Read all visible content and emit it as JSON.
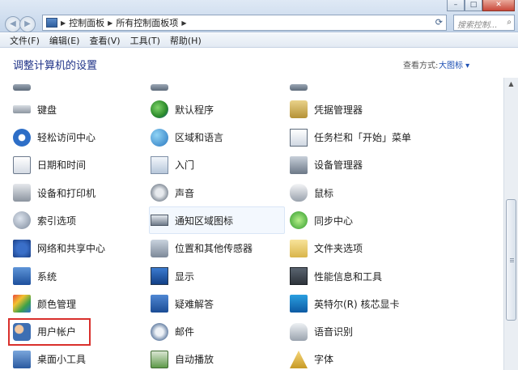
{
  "window": {
    "controls": {
      "minimize": "–",
      "maximize": "□",
      "close": "✕"
    },
    "nav": {
      "back": "◀",
      "forward": "▶"
    }
  },
  "address": {
    "segments": [
      "控制面板",
      "所有控制面板项"
    ],
    "search_placeholder": "搜索控制..."
  },
  "menu": [
    "文件(F)",
    "编辑(E)",
    "查看(V)",
    "工具(T)",
    "帮助(H)"
  ],
  "header": {
    "title": "调整计算机的设置",
    "view_by_label": "查看方式:",
    "view_mode": "大图标 ▾"
  },
  "items": [
    [
      {
        "label": "",
        "icon": "partial-icon"
      },
      {
        "label": "",
        "icon": "partial-icon"
      },
      {
        "label": "",
        "icon": "partial-icon"
      }
    ],
    [
      {
        "label": "键盘",
        "icon": "keyboard-icon"
      },
      {
        "label": "默认程序",
        "icon": "default-programs-icon"
      },
      {
        "label": "凭据管理器",
        "icon": "credential-manager-icon"
      }
    ],
    [
      {
        "label": "轻松访问中心",
        "icon": "ease-of-access-icon"
      },
      {
        "label": "区域和语言",
        "icon": "region-language-icon"
      },
      {
        "label": "任务栏和「开始」菜单",
        "icon": "taskbar-icon"
      }
    ],
    [
      {
        "label": "日期和时间",
        "icon": "date-time-icon"
      },
      {
        "label": "入门",
        "icon": "getting-started-icon"
      },
      {
        "label": "设备管理器",
        "icon": "device-manager-icon"
      }
    ],
    [
      {
        "label": "设备和打印机",
        "icon": "printer-icon"
      },
      {
        "label": "声音",
        "icon": "sound-icon"
      },
      {
        "label": "鼠标",
        "icon": "mouse-icon"
      }
    ],
    [
      {
        "label": "索引选项",
        "icon": "indexing-icon"
      },
      {
        "label": "通知区域图标",
        "icon": "notification-icon"
      },
      {
        "label": "同步中心",
        "icon": "sync-center-icon"
      }
    ],
    [
      {
        "label": "网络和共享中心",
        "icon": "network-icon"
      },
      {
        "label": "位置和其他传感器",
        "icon": "sensor-icon"
      },
      {
        "label": "文件夹选项",
        "icon": "folder-options-icon"
      }
    ],
    [
      {
        "label": "系统",
        "icon": "system-icon"
      },
      {
        "label": "显示",
        "icon": "display-icon"
      },
      {
        "label": "性能信息和工具",
        "icon": "performance-icon"
      }
    ],
    [
      {
        "label": "颜色管理",
        "icon": "color-management-icon"
      },
      {
        "label": "疑难解答",
        "icon": "troubleshooting-icon"
      },
      {
        "label": "英特尔(R) 核芯显卡",
        "icon": "intel-graphics-icon"
      }
    ],
    [
      {
        "label": "用户帐户",
        "icon": "user-accounts-icon"
      },
      {
        "label": "邮件",
        "icon": "mail-icon"
      },
      {
        "label": "语音识别",
        "icon": "speech-icon"
      }
    ],
    [
      {
        "label": "桌面小工具",
        "icon": "gadgets-icon"
      },
      {
        "label": "自动播放",
        "icon": "autoplay-icon"
      },
      {
        "label": "字体",
        "icon": "fonts-icon"
      }
    ]
  ],
  "highlighted_item": "通知区域图标",
  "outlined_item": "用户帐户"
}
